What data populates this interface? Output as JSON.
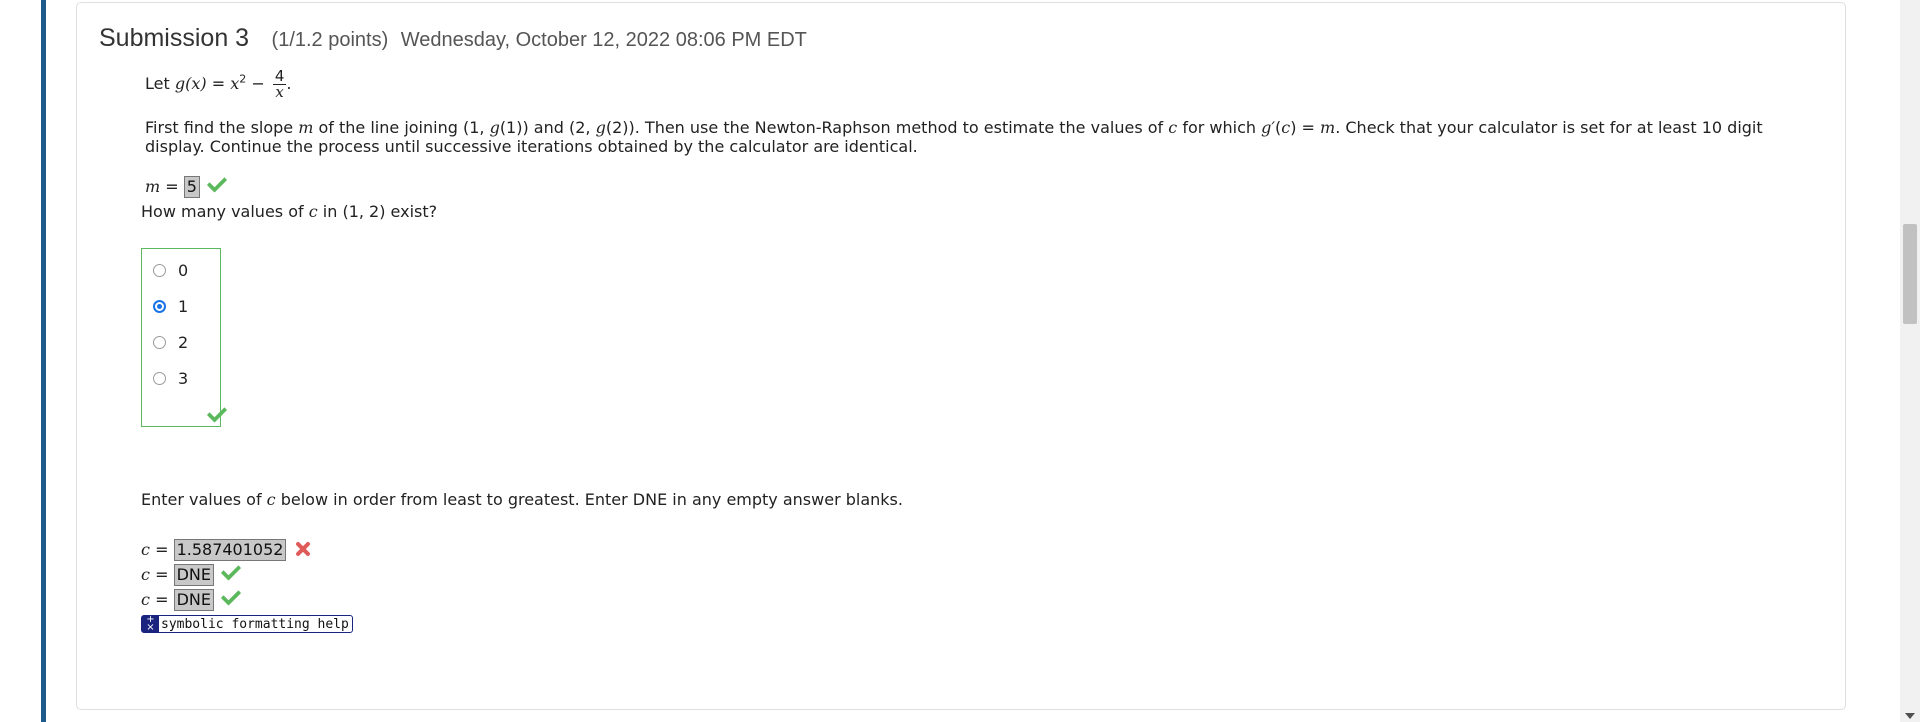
{
  "submission": {
    "title": "Submission 3",
    "points": "(1/1.2 points)",
    "date": "Wednesday, October 12, 2022 08:06 PM EDT"
  },
  "problem": {
    "let": "Let",
    "func": "g(x)",
    "eq": "=",
    "x": "x",
    "sq": "2",
    "minus": "−",
    "frac_num": "4",
    "frac_den": "x",
    "period": ".",
    "para_1": "First find the slope",
    "para_m": "m",
    "para_2": "of the line joining (1,",
    "para_g1": "g",
    "para_3": "(1)) and (2,",
    "para_g2": "g",
    "para_4": "(2)). Then use the Newton-Raphson method to estimate the values of",
    "para_c": "c",
    "para_5": "for which",
    "para_gp": "g′",
    "para_6": "(",
    "para_c2": "c",
    "para_7": ") =",
    "para_m2": "m",
    "para_8": ". Check that your calculator is set for at least 10 digit display. Continue the process until successive iterations obtained by the calculator are identical."
  },
  "slope": {
    "var": "m",
    "eq": "=",
    "value": "5",
    "status": "correct"
  },
  "question": {
    "pre": "How many values of",
    "var": "c",
    "post": "in (1, 2) exist?"
  },
  "radio_options": [
    {
      "label": "0",
      "checked": false
    },
    {
      "label": "1",
      "checked": true
    },
    {
      "label": "2",
      "checked": false
    },
    {
      "label": "3",
      "checked": false
    }
  ],
  "instruction": {
    "pre": "Enter values of",
    "var": "c",
    "post": "below in order from least to greatest. Enter DNE in any empty answer blanks."
  },
  "c_answers": [
    {
      "var": "c",
      "eq": "=",
      "value": "1.587401052",
      "status": "incorrect"
    },
    {
      "var": "c",
      "eq": "=",
      "value": "DNE",
      "status": "correct"
    },
    {
      "var": "c",
      "eq": "=",
      "value": "DNE",
      "status": "correct"
    }
  ],
  "help": {
    "icon": "plus-minus-icon",
    "label": "symbolic formatting help"
  },
  "colors": {
    "accent_bar": "#1d5b8c",
    "correct": "#5cb85c",
    "incorrect": "#e05a5a",
    "selected_radio": "#1a73e8"
  }
}
